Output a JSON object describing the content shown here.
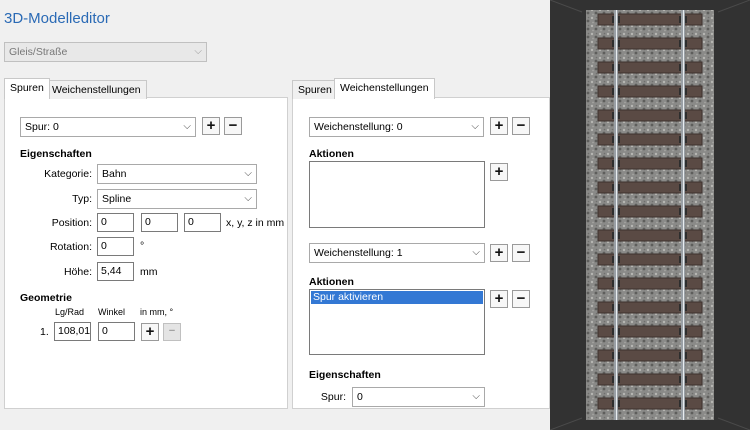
{
  "app": {
    "title": "3D-Modelleditor"
  },
  "top_combo": {
    "value": "Gleis/Straße"
  },
  "left": {
    "tabs": [
      "Spuren",
      "Weichenstellungen"
    ],
    "spur_combo": "Spur: 0",
    "props_heading": "Eigenschaften",
    "kategorie_label": "Kategorie:",
    "kategorie_value": "Bahn",
    "typ_label": "Typ:",
    "typ_value": "Spline",
    "position_label": "Position:",
    "position_values": [
      "0",
      "0",
      "0"
    ],
    "position_unit": "x, y, z in mm",
    "rotation_label": "Rotation:",
    "rotation_value": "0",
    "rotation_unit": "°",
    "hoehe_label": "Höhe:",
    "hoehe_value": "5,44",
    "hoehe_unit": "mm",
    "geom_heading": "Geometrie",
    "geom_col1": "Lg/Rad",
    "geom_col2": "Winkel",
    "geom_col3": "in mm, °",
    "geom_row_index": "1.",
    "geom_row_lg": "108,01",
    "geom_row_winkel": "0"
  },
  "right": {
    "tabs": [
      "Spuren",
      "Weichenstellungen"
    ],
    "weiche0_combo": "Weichenstellung: 0",
    "aktionen1_heading": "Aktionen",
    "weiche1_combo": "Weichenstellung: 1",
    "aktionen2_heading": "Aktionen",
    "aktionen2_item": "Spur aktivieren",
    "props_heading": "Eigenschaften",
    "spur_label": "Spur:",
    "spur_value": "0"
  },
  "icons": {
    "plus": "+",
    "minus": "−",
    "dropdown": "⌵"
  }
}
